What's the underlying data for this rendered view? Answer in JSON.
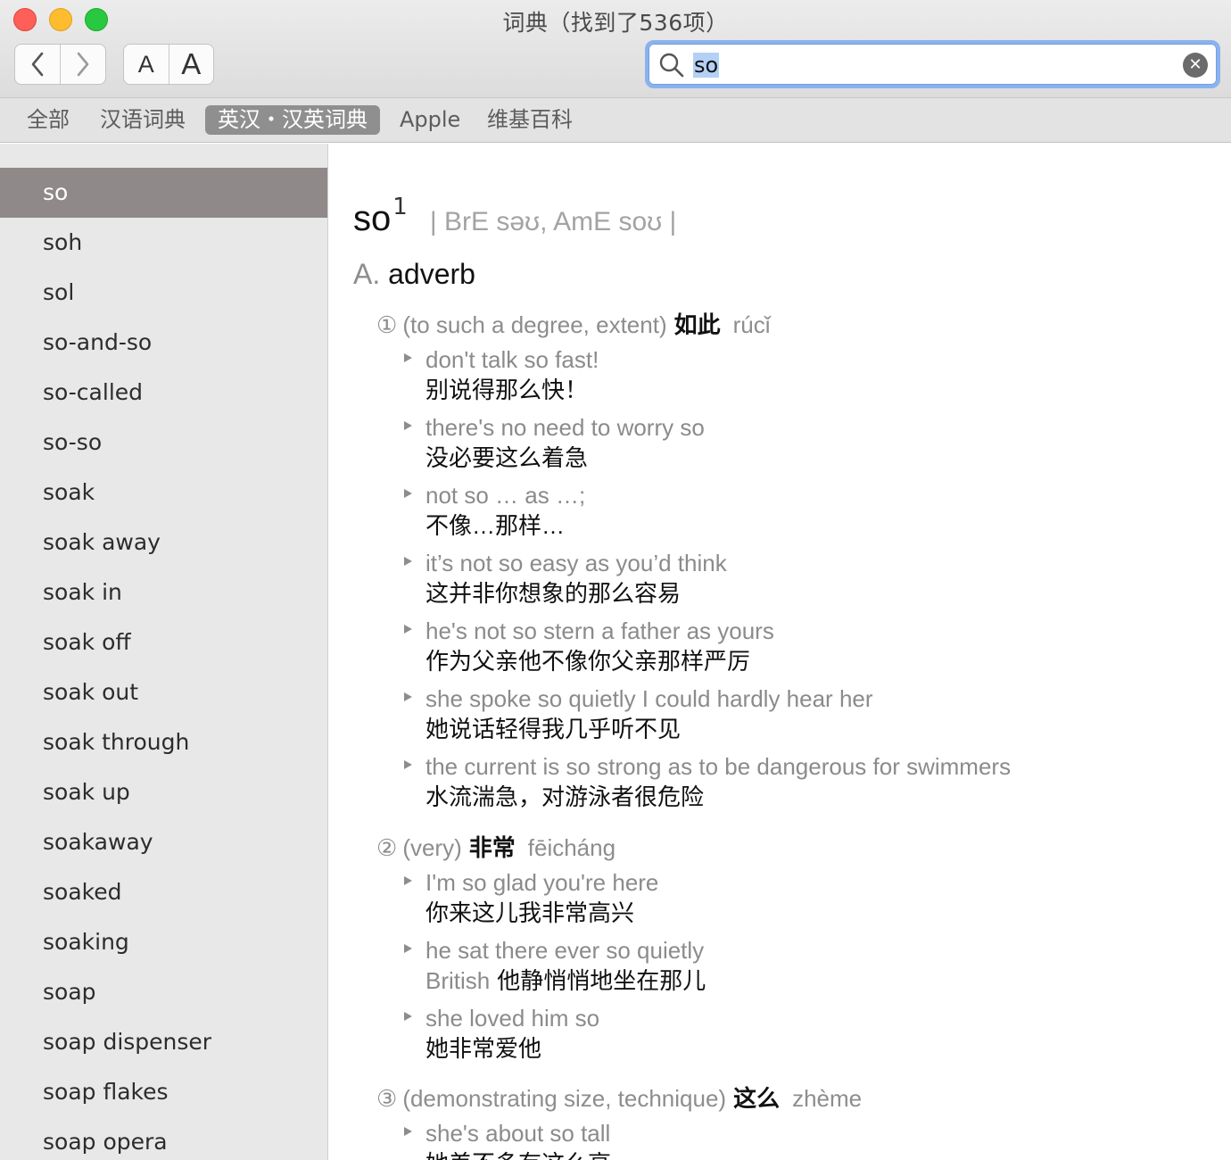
{
  "window": {
    "title": "词典（找到了536项）"
  },
  "toolbar": {
    "back_icon": "chevron-left-icon",
    "forward_icon": "chevron-right-icon",
    "font_smaller_label": "A",
    "font_larger_label": "A"
  },
  "search": {
    "query": "so",
    "icons": [
      "magnifier-icon",
      "clear-icon"
    ],
    "accent_color": "#8ab2ee"
  },
  "tabs": [
    {
      "label": "全部",
      "active": false
    },
    {
      "label": "汉语词典",
      "active": false
    },
    {
      "label": "英汉・汉英词典",
      "active": true
    },
    {
      "label": "Apple",
      "active": false
    },
    {
      "label": "维基百科",
      "active": false
    }
  ],
  "sidebar": {
    "selected_color": "#8f8a89",
    "items": [
      "so",
      "soh",
      "sol",
      "so-and-so",
      "so-called",
      "so-so",
      "soak",
      "soak away",
      "soak in",
      "soak off",
      "soak out",
      "soak through",
      "soak up",
      "soakaway",
      "soaked",
      "soaking",
      "soap",
      "soap dispenser",
      "soap flakes",
      "soap opera"
    ]
  },
  "entry": {
    "headword": "so",
    "homograph": "1",
    "pronunciation": "| BrE səʊ,  AmE soʊ |",
    "pos_letter": "A.",
    "pos": "adverb",
    "senses": [
      {
        "num": "①",
        "gloss": "(to such a degree, extent)",
        "zh": "如此",
        "pinyin": "rúcǐ"
      },
      {
        "num": "②",
        "gloss": "(very)",
        "zh": "非常",
        "pinyin": "fēicháng"
      },
      {
        "num": "③",
        "gloss": "(demonstrating size, technique)",
        "zh": "这么",
        "pinyin": "zhème"
      }
    ],
    "examples": [
      {
        "en": "don't talk so fast!",
        "zh": "别说得那么快！",
        "register": ""
      },
      {
        "en": "there's no need to worry so",
        "zh": "没必要这么着急",
        "register": ""
      },
      {
        "en": "not so … as …;",
        "zh": "不像…那样…",
        "register": ""
      },
      {
        "en": "it’s not so easy as you’d think",
        "zh": "这并非你想象的那么容易",
        "register": ""
      },
      {
        "en": "he's not so stern a father as yours",
        "zh": "作为父亲他不像你父亲那样严厉",
        "register": ""
      },
      {
        "en": "she spoke so quietly I could hardly hear her",
        "zh": "她说话轻得我几乎听不见",
        "register": ""
      },
      {
        "en": "the current is so strong as to be dangerous for swimmers",
        "zh": "水流湍急，对游泳者很危险",
        "register": ""
      },
      {
        "en": "I'm so glad you're here",
        "zh": "你来这儿我非常高兴",
        "register": ""
      },
      {
        "en": "he sat there ever so quietly",
        "zh": "他静悄悄地坐在那儿",
        "register": "British"
      },
      {
        "en": "she loved him so",
        "zh": "她非常爱他",
        "register": ""
      },
      {
        "en": "she's about so tall",
        "zh": "她差不多有这么高",
        "register": ""
      }
    ]
  }
}
